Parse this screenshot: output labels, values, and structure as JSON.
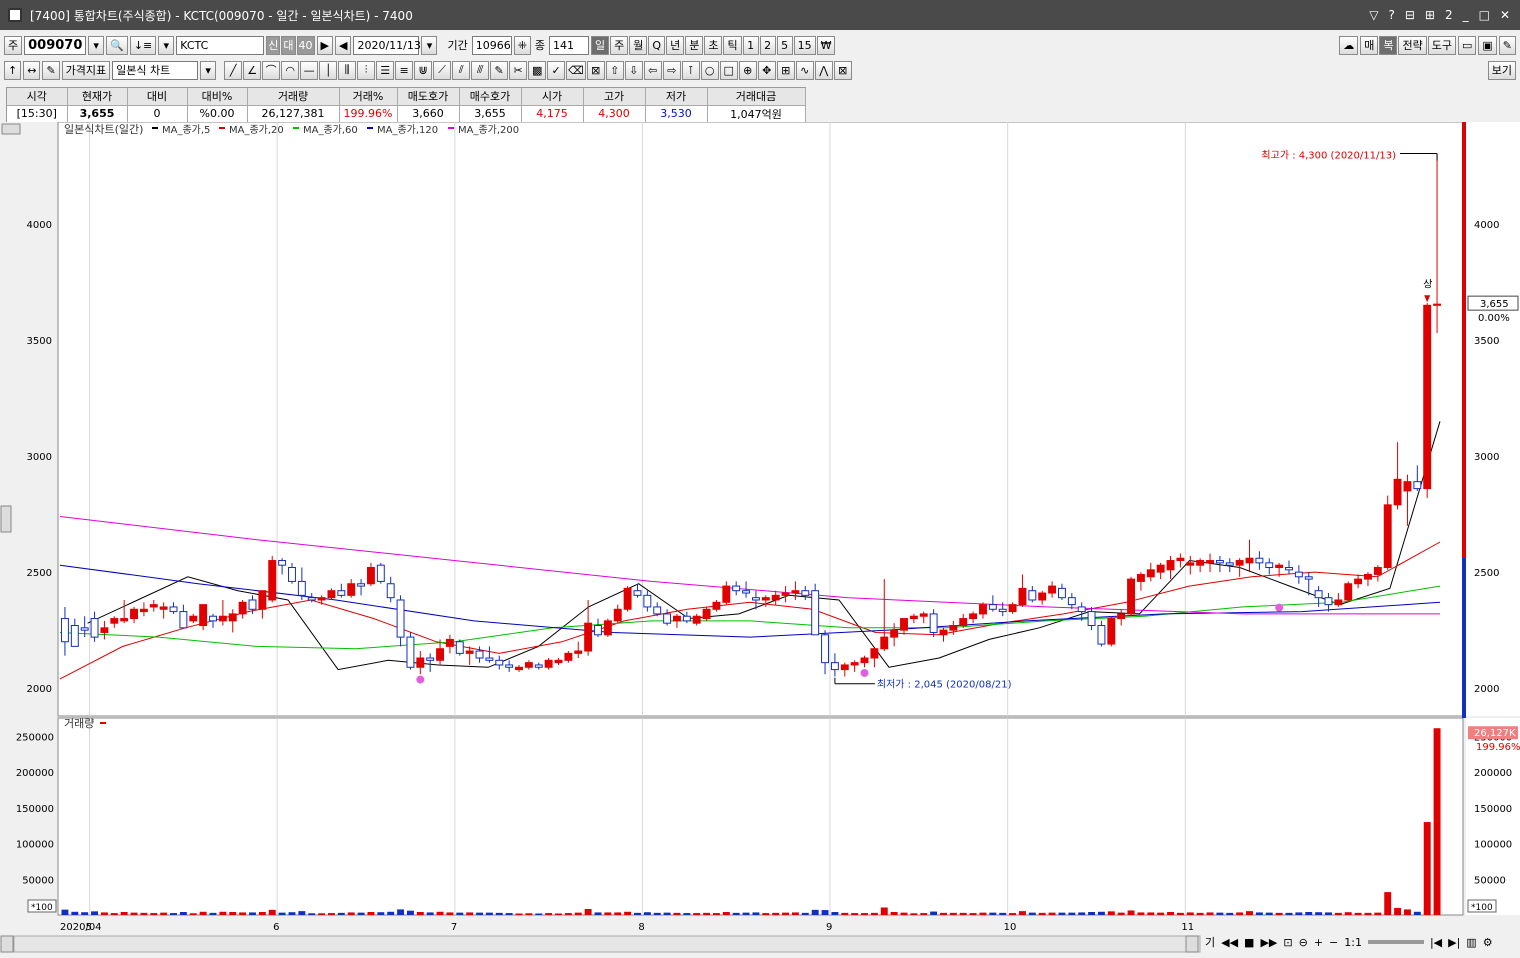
{
  "window": {
    "title": "[7400] 통합차트(주식종합) - KCTC(009070 - 일간 - 일본식차트) - 7400",
    "right_icons": [
      "▽",
      "?",
      "⊟",
      "⊞",
      "2",
      "_",
      "□",
      "✕"
    ]
  },
  "toolbar1": {
    "market": "주",
    "code": "009070",
    "name": "KCTC",
    "badges": [
      "신",
      "대",
      "40"
    ],
    "date": "2020/11/13",
    "period_label": "기간",
    "period_value": "10966",
    "count_label": "종",
    "count_value": "141",
    "intervals": [
      "일",
      "주",
      "월",
      "Q",
      "년",
      "분",
      "초",
      "틱",
      "1",
      "2",
      "5",
      "15",
      "₩"
    ],
    "right_buttons": [
      "매",
      "복",
      "전략",
      "도구"
    ]
  },
  "toolbar2": {
    "indicator": "가격지표",
    "chart_type": "일본식 차트",
    "view_button": "보기"
  },
  "quote": {
    "headers": [
      "시각",
      "현재가",
      "대비",
      "대비%",
      "거래량",
      "거래%",
      "매도호가",
      "매수호가",
      "시가",
      "고가",
      "저가",
      "거래대금"
    ],
    "values": [
      "[15:30]",
      "3,655",
      "0",
      "%0.00",
      "26,127,381",
      "199.96%",
      "3,660",
      "3,655",
      "4,175",
      "4,300",
      "3,530",
      "1,047억원"
    ]
  },
  "chart_data": [
    {
      "type": "candlestick",
      "title": "일본식차트(일간)",
      "legend": [
        "MA_종가,5",
        "MA_종가,20",
        "MA_종가,60",
        "MA_종가,120",
        "MA_종가,200"
      ],
      "legend_colors": [
        "#000000",
        "#e00000",
        "#00c000",
        "#0000c0",
        "#e000e0"
      ],
      "yticks": [
        4000,
        3500,
        3000,
        2500,
        2000
      ],
      "ylim": [
        1880,
        4440
      ],
      "xticks": [
        "2020/04",
        "5",
        "6",
        "7",
        "8",
        "9",
        "10",
        "11"
      ],
      "annotations": {
        "high": "최고가 : 4,300 (2020/11/13)",
        "low": "최저가 : 2,045 (2020/08/21)",
        "limit": "상"
      },
      "current_price": "3,655",
      "current_change": "0.00%",
      "candles": [
        [
          2300,
          2350,
          2140,
          2200
        ],
        [
          2270,
          2300,
          2190,
          2180
        ],
        [
          2260,
          2310,
          2220,
          2250
        ],
        [
          2300,
          2330,
          2200,
          2220
        ],
        [
          2240,
          2290,
          2210,
          2260
        ],
        [
          2280,
          2310,
          2260,
          2300
        ],
        [
          2290,
          2380,
          2280,
          2300
        ],
        [
          2300,
          2350,
          2280,
          2340
        ],
        [
          2330,
          2370,
          2310,
          2340
        ],
        [
          2350,
          2380,
          2330,
          2360
        ],
        [
          2340,
          2370,
          2300,
          2350
        ],
        [
          2350,
          2370,
          2320,
          2330
        ],
        [
          2330,
          2360,
          2260,
          2260
        ],
        [
          2290,
          2320,
          2280,
          2310
        ],
        [
          2270,
          2360,
          2250,
          2360
        ],
        [
          2310,
          2320,
          2260,
          2290
        ],
        [
          2290,
          2380,
          2270,
          2310
        ],
        [
          2290,
          2340,
          2240,
          2320
        ],
        [
          2320,
          2380,
          2300,
          2370
        ],
        [
          2380,
          2400,
          2320,
          2340
        ],
        [
          2340,
          2400,
          2300,
          2420
        ],
        [
          2380,
          2570,
          2370,
          2550
        ],
        [
          2550,
          2560,
          2490,
          2530
        ],
        [
          2520,
          2540,
          2450,
          2460
        ],
        [
          2460,
          2520,
          2380,
          2400
        ],
        [
          2390,
          2410,
          2370,
          2380
        ],
        [
          2380,
          2400,
          2360,
          2390
        ],
        [
          2390,
          2430,
          2380,
          2420
        ],
        [
          2420,
          2450,
          2390,
          2400
        ],
        [
          2400,
          2470,
          2390,
          2450
        ],
        [
          2450,
          2470,
          2400,
          2440
        ],
        [
          2450,
          2540,
          2440,
          2520
        ],
        [
          2530,
          2540,
          2450,
          2460
        ],
        [
          2450,
          2480,
          2370,
          2390
        ],
        [
          2380,
          2400,
          2180,
          2220
        ],
        [
          2220,
          2240,
          2080,
          2090
        ],
        [
          2090,
          2160,
          2060,
          2130
        ],
        [
          2130,
          2150,
          2070,
          2120
        ],
        [
          2120,
          2210,
          2100,
          2170
        ],
        [
          2180,
          2230,
          2150,
          2210
        ],
        [
          2200,
          2210,
          2140,
          2150
        ],
        [
          2150,
          2180,
          2100,
          2160
        ],
        [
          2160,
          2180,
          2110,
          2130
        ],
        [
          2130,
          2180,
          2110,
          2120
        ],
        [
          2120,
          2140,
          2080,
          2100
        ],
        [
          2100,
          2120,
          2070,
          2090
        ],
        [
          2080,
          2100,
          2070,
          2090
        ],
        [
          2090,
          2120,
          2080,
          2110
        ],
        [
          2100,
          2110,
          2080,
          2090
        ],
        [
          2090,
          2130,
          2080,
          2120
        ],
        [
          2110,
          2130,
          2100,
          2120
        ],
        [
          2120,
          2160,
          2110,
          2150
        ],
        [
          2150,
          2200,
          2130,
          2160
        ],
        [
          2160,
          2380,
          2140,
          2280
        ],
        [
          2270,
          2300,
          2220,
          2230
        ],
        [
          2230,
          2300,
          2220,
          2290
        ],
        [
          2290,
          2360,
          2280,
          2340
        ],
        [
          2340,
          2440,
          2330,
          2430
        ],
        [
          2420,
          2450,
          2390,
          2400
        ],
        [
          2400,
          2420,
          2330,
          2350
        ],
        [
          2350,
          2370,
          2310,
          2320
        ],
        [
          2320,
          2340,
          2270,
          2280
        ],
        [
          2290,
          2320,
          2260,
          2310
        ],
        [
          2310,
          2330,
          2280,
          2290
        ],
        [
          2280,
          2320,
          2270,
          2310
        ],
        [
          2300,
          2350,
          2290,
          2340
        ],
        [
          2340,
          2380,
          2330,
          2370
        ],
        [
          2370,
          2460,
          2360,
          2440
        ],
        [
          2440,
          2460,
          2400,
          2420
        ],
        [
          2420,
          2460,
          2390,
          2410
        ],
        [
          2390,
          2420,
          2340,
          2380
        ],
        [
          2380,
          2400,
          2350,
          2390
        ],
        [
          2380,
          2420,
          2360,
          2400
        ],
        [
          2400,
          2440,
          2370,
          2410
        ],
        [
          2410,
          2460,
          2380,
          2420
        ],
        [
          2420,
          2440,
          2380,
          2400
        ],
        [
          2420,
          2450,
          2250,
          2230
        ],
        [
          2230,
          2250,
          2060,
          2110
        ],
        [
          2110,
          2150,
          2050,
          2080
        ],
        [
          2080,
          2110,
          2050,
          2100
        ],
        [
          2100,
          2120,
          2070,
          2110
        ],
        [
          2110,
          2140,
          2090,
          2130
        ],
        [
          2130,
          2150,
          2090,
          2170
        ],
        [
          2170,
          2470,
          2160,
          2220
        ],
        [
          2220,
          2280,
          2180,
          2250
        ],
        [
          2250,
          2300,
          2230,
          2300
        ],
        [
          2300,
          2320,
          2280,
          2310
        ],
        [
          2310,
          2330,
          2280,
          2320
        ],
        [
          2320,
          2340,
          2220,
          2240
        ],
        [
          2230,
          2260,
          2200,
          2250
        ],
        [
          2250,
          2290,
          2230,
          2270
        ],
        [
          2270,
          2320,
          2260,
          2300
        ],
        [
          2300,
          2330,
          2280,
          2320
        ],
        [
          2320,
          2370,
          2300,
          2360
        ],
        [
          2360,
          2400,
          2330,
          2340
        ],
        [
          2340,
          2370,
          2310,
          2330
        ],
        [
          2330,
          2370,
          2320,
          2360
        ],
        [
          2360,
          2490,
          2350,
          2430
        ],
        [
          2420,
          2440,
          2370,
          2380
        ],
        [
          2380,
          2420,
          2360,
          2410
        ],
        [
          2410,
          2460,
          2390,
          2440
        ],
        [
          2430,
          2450,
          2380,
          2390
        ],
        [
          2390,
          2410,
          2340,
          2360
        ],
        [
          2350,
          2370,
          2290,
          2330
        ],
        [
          2330,
          2350,
          2250,
          2270
        ],
        [
          2270,
          2290,
          2180,
          2190
        ],
        [
          2190,
          2310,
          2180,
          2300
        ],
        [
          2300,
          2340,
          2270,
          2320
        ],
        [
          2320,
          2480,
          2310,
          2470
        ],
        [
          2460,
          2500,
          2420,
          2490
        ],
        [
          2480,
          2540,
          2460,
          2510
        ],
        [
          2500,
          2540,
          2470,
          2530
        ],
        [
          2510,
          2570,
          2470,
          2550
        ],
        [
          2550,
          2580,
          2520,
          2560
        ],
        [
          2530,
          2570,
          2490,
          2540
        ],
        [
          2530,
          2560,
          2500,
          2550
        ],
        [
          2540,
          2580,
          2500,
          2550
        ],
        [
          2550,
          2570,
          2500,
          2540
        ],
        [
          2540,
          2560,
          2500,
          2530
        ],
        [
          2530,
          2560,
          2480,
          2550
        ],
        [
          2540,
          2640,
          2500,
          2560
        ],
        [
          2560,
          2590,
          2510,
          2540
        ],
        [
          2540,
          2560,
          2490,
          2520
        ],
        [
          2520,
          2540,
          2480,
          2530
        ],
        [
          2520,
          2550,
          2490,
          2510
        ],
        [
          2500,
          2530,
          2450,
          2480
        ],
        [
          2480,
          2500,
          2400,
          2470
        ],
        [
          2420,
          2440,
          2350,
          2390
        ],
        [
          2390,
          2410,
          2330,
          2360
        ],
        [
          2360,
          2410,
          2350,
          2380
        ],
        [
          2380,
          2460,
          2370,
          2450
        ],
        [
          2450,
          2490,
          2430,
          2470
        ],
        [
          2470,
          2500,
          2440,
          2490
        ],
        [
          2490,
          2530,
          2460,
          2520
        ],
        [
          2520,
          2830,
          2510,
          2790
        ],
        [
          2790,
          3060,
          2770,
          2900
        ],
        [
          2850,
          2920,
          2700,
          2890
        ],
        [
          2890,
          2960,
          2850,
          2860
        ],
        [
          2860,
          3660,
          2820,
          3650
        ],
        [
          3650,
          4300,
          3530,
          3655
        ]
      ],
      "ma_series": {
        "MA_종가,5": [
          2280,
          2380,
          2480,
          2420,
          2380,
          2080,
          2120,
          2100,
          2090,
          2180,
          2350,
          2450,
          2300,
          2320,
          2400,
          2380,
          2090,
          2130,
          2210,
          2260,
          2330,
          2320,
          2550,
          2520,
          2440,
          2360,
          2430,
          3150
        ],
        "MA_종가,20": [
          2040,
          2180,
          2260,
          2330,
          2380,
          2300,
          2200,
          2150,
          2200,
          2290,
          2340,
          2370,
          2340,
          2240,
          2230,
          2280,
          2320,
          2370,
          2440,
          2480,
          2500,
          2480,
          2630
        ],
        "MA_종가,60": [
          2240,
          2220,
          2180,
          2170,
          2200,
          2260,
          2290,
          2290,
          2260,
          2260,
          2290,
          2310,
          2350,
          2370,
          2440
        ],
        "MA_종가,120": [
          2530,
          2450,
          2380,
          2290,
          2240,
          2220,
          2250,
          2290,
          2320,
          2330,
          2370
        ],
        "MA_종가,200": [
          2740,
          2640,
          2550,
          2460,
          2390,
          2350,
          2320,
          2320
        ]
      }
    },
    {
      "type": "bar",
      "title": "거래량",
      "yticks": [
        250000,
        200000,
        150000,
        100000,
        50000
      ],
      "ylim": [
        0,
        270000
      ],
      "scale_label": "*100",
      "last_value": "26,127K",
      "last_pct": "199.96%"
    }
  ]
}
